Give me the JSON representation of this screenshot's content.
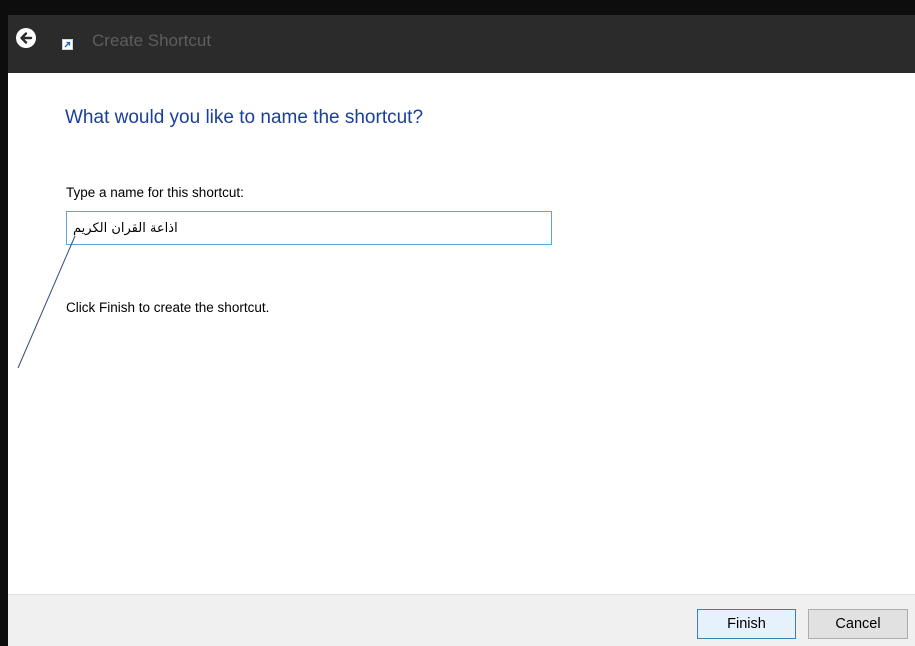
{
  "window": {
    "title": "Create Shortcut"
  },
  "wizard": {
    "heading": "What would you like to name the shortcut?",
    "field_label": "Type a name for this shortcut:",
    "name_value": "اذاعة القران الكريم",
    "instruction": "Click Finish to create the shortcut."
  },
  "buttons": {
    "finish_label": "Finish",
    "cancel_label": "Cancel"
  },
  "icons": {
    "back": "back-arrow-icon",
    "shortcut": "shortcut-icon"
  },
  "colors": {
    "titlebar": "#2b2b2b",
    "heading": "#1a3e9c",
    "input_border": "#5aa4e2"
  }
}
